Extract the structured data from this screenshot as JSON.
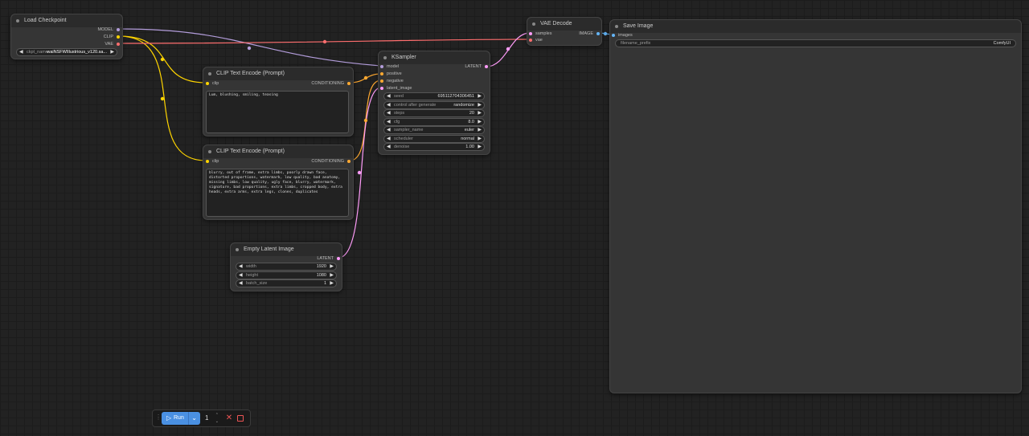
{
  "colors": {
    "model": "#b39ddb",
    "clip": "#ffd500",
    "vae": "#ff6e6e",
    "conditioning": "#ffa931",
    "latent": "#ff9cf9",
    "image": "#64b5f6"
  },
  "load_checkpoint": {
    "title": "Load Checkpoint",
    "outputs": [
      "MODEL",
      "CLIP",
      "VAE"
    ],
    "ckpt_label": "ckpt_name",
    "ckpt_value": "waiNSFWIllustrious_v120.sa..."
  },
  "clip_pos": {
    "title": "CLIP Text Encode (Prompt)",
    "input": "clip",
    "output": "CONDITIONING",
    "text": "Lum, blushing, smiling, teasing"
  },
  "clip_neg": {
    "title": "CLIP Text Encode (Prompt)",
    "input": "clip",
    "output": "CONDITIONING",
    "text": "blurry, out of frame, extra limbs, poorly drawn face, distorted proportions, watermark, low quality, bad anatomy, missing limbs, low quality, ugly face, blurry, watermark, signature, bad proportions, extra limbs, cropped body, extra heads, extra arms, extra legs, clones, duplicates"
  },
  "ksampler": {
    "title": "KSampler",
    "inputs": [
      "model",
      "positive",
      "negative",
      "latent_image"
    ],
    "output": "LATENT",
    "widgets": [
      {
        "label": "seed",
        "value": "695112704306451"
      },
      {
        "label": "control after generate",
        "value": "randomize"
      },
      {
        "label": "steps",
        "value": "20"
      },
      {
        "label": "cfg",
        "value": "8.0"
      },
      {
        "label": "sampler_name",
        "value": "euler"
      },
      {
        "label": "scheduler",
        "value": "normal"
      },
      {
        "label": "denoise",
        "value": "1.00"
      }
    ]
  },
  "vae_decode": {
    "title": "VAE Decode",
    "inputs": [
      "samples",
      "vae"
    ],
    "output": "IMAGE"
  },
  "save_image": {
    "title": "Save Image",
    "input": "images",
    "prefix_label": "filename_prefix",
    "prefix_value": "ComfyUI"
  },
  "empty_latent": {
    "title": "Empty Latent Image",
    "output": "LATENT",
    "widgets": [
      {
        "label": "width",
        "value": "1920"
      },
      {
        "label": "height",
        "value": "1080"
      },
      {
        "label": "batch_size",
        "value": "1"
      }
    ]
  },
  "runbar": {
    "run_label": "Run",
    "batch_count": "1"
  }
}
